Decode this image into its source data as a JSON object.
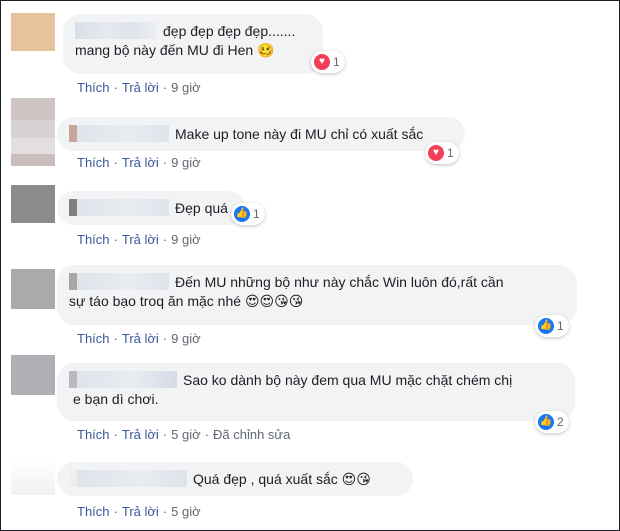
{
  "colors": {
    "bubble": "#f2f3f5",
    "link": "#385898",
    "meta": "#606770",
    "love": "#f33e58",
    "like": "#1877f2"
  },
  "comments": [
    {
      "text_line1": "đẹp đẹp đẹp đẹp.......",
      "text_line2": "mang bộ này đến MU đi Hen",
      "emoji": "🥴",
      "reaction": "love-icon",
      "reaction_count": "1",
      "like_label": "Thích",
      "reply_label": "Trả lời",
      "time": "9 giờ"
    },
    {
      "text": "Make up tone này đi MU chỉ có xuất sắc",
      "reaction": "love-icon",
      "reaction_count": "1",
      "like_label": "Thích",
      "reply_label": "Trả lời",
      "time": "9 giờ"
    },
    {
      "text": "Đẹp quá",
      "reaction": "like-icon",
      "reaction_count": "1",
      "like_label": "Thích",
      "reply_label": "Trả lời",
      "time": "9 giờ"
    },
    {
      "text_line1": "Đến MU những bộ như này chắc Win luôn đó,rất cần",
      "text_line2": "sự táo bạo troq ăn mặc nhé",
      "emoji": "😍😍😘😘",
      "reaction": "like-icon",
      "reaction_count": "1",
      "like_label": "Thích",
      "reply_label": "Trả lời",
      "time": "9 giờ"
    },
    {
      "text_line1": "Sao ko dành bộ này đem qua MU mặc chặt chém chị",
      "text_line2": "e bạn dì chơi.",
      "reaction": "like-icon",
      "reaction_count": "2",
      "like_label": "Thích",
      "reply_label": "Trả lời",
      "time": "5 giờ",
      "edited_label": "Đã chỉnh sửa"
    },
    {
      "text": "Quá đẹp , quá xuất sắc",
      "emoji": "😍😘",
      "like_label": "Thích",
      "reply_label": "Trả lời",
      "time": "5 giờ"
    }
  ]
}
